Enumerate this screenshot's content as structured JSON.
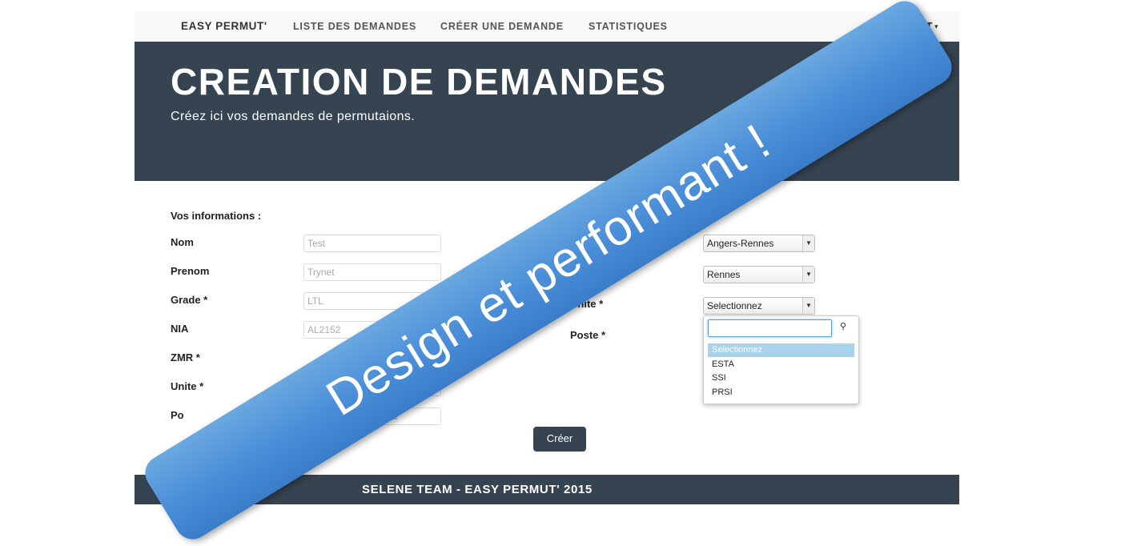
{
  "navbar": {
    "brand": "EASY PERMUT'",
    "links": [
      "LISTE DES DEMANDES",
      "CRÉER UNE DEMANDE",
      "STATISTIQUES"
    ],
    "user": "TEST"
  },
  "header": {
    "title": "CREATION DE DEMANDES",
    "subtitle": "Créez ici vos demandes de permutaions."
  },
  "form": {
    "section_title": "Vos informations :",
    "left_labels": [
      "Nom",
      "Prenom",
      "Grade *",
      "NIA",
      "ZMR *",
      "Unite *",
      "Po"
    ],
    "left_values": [
      "Test",
      "Trynet",
      "LTL",
      "AL2152",
      "",
      "ur Java"
    ],
    "right_selects": [
      "Angers-Rennes",
      "Rennes",
      "Selectionnez"
    ],
    "right_labels": [
      "Unite *",
      "Poste *"
    ],
    "dropdown_search_icon": "search-icon",
    "dropdown_options": [
      "Selectionnez",
      "ESTA",
      "SSI",
      "PRSI"
    ],
    "submit_label": "Créer"
  },
  "footer": {
    "text": "SELENE TEAM - EASY PERMUT' 2015"
  },
  "banner": {
    "text": "Design et performant !"
  }
}
